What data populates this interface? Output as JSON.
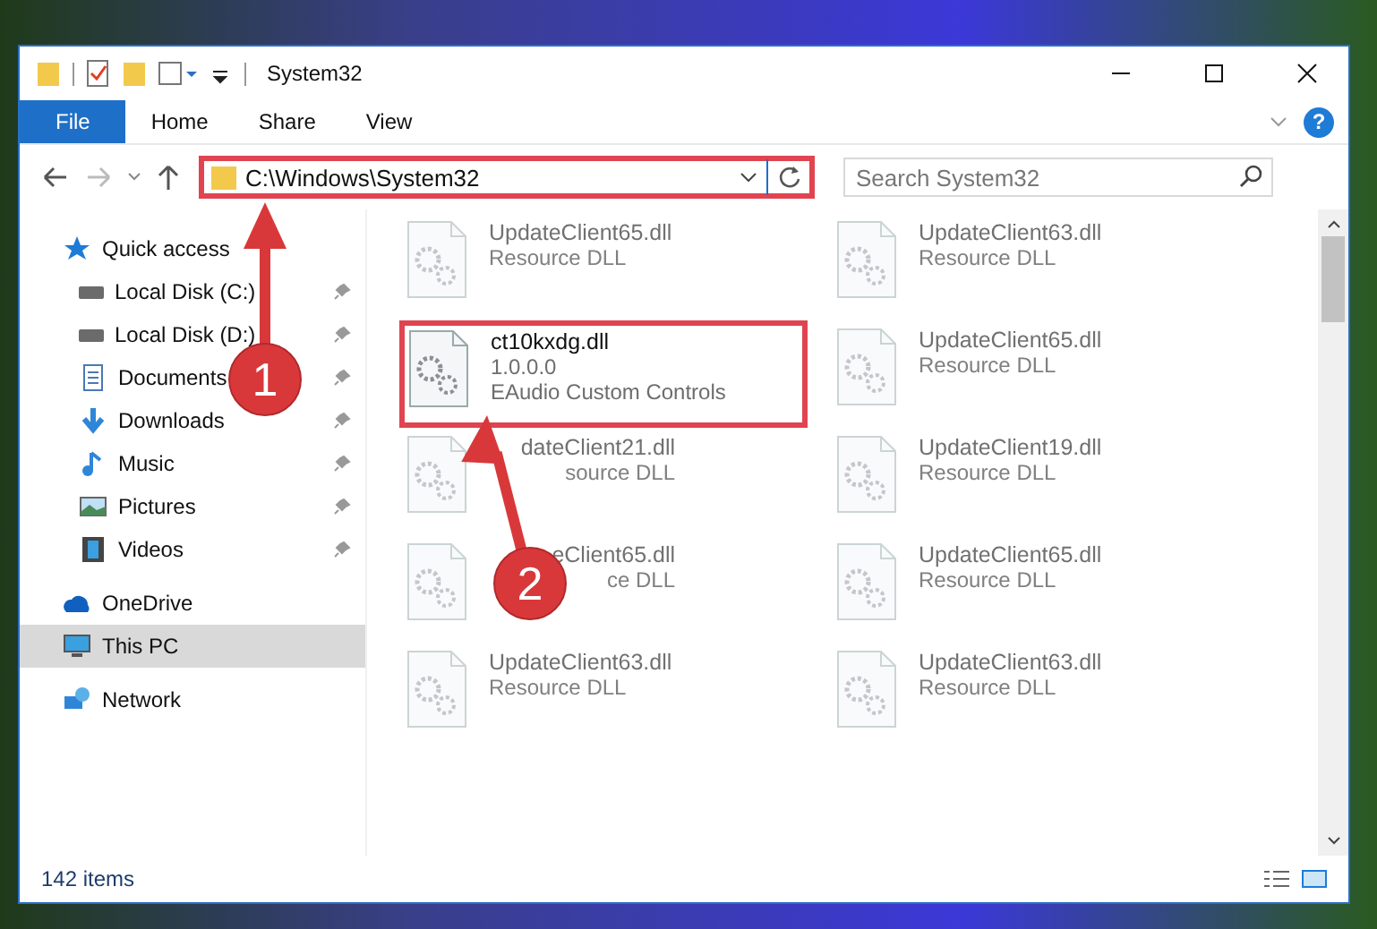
{
  "window": {
    "title": "System32"
  },
  "ribbon_tabs": [
    {
      "label": "File",
      "selected": true
    },
    {
      "label": "Home",
      "selected": false
    },
    {
      "label": "Share",
      "selected": false
    },
    {
      "label": "View",
      "selected": false
    }
  ],
  "help_button": {
    "label": "?"
  },
  "address_bar": {
    "path": "C:\\Windows\\System32",
    "highlighted": true
  },
  "search": {
    "placeholder": "Search System32"
  },
  "sidebar": {
    "items": [
      {
        "label": "Quick access",
        "kind": "star",
        "pinned": false,
        "selected": false,
        "children": [
          {
            "label": "Local Disk (C:)",
            "kind": "drive",
            "pinned": true,
            "selected": false
          },
          {
            "label": "Local Disk (D:)",
            "kind": "drive",
            "pinned": true,
            "selected": false
          },
          {
            "label": "Documents",
            "kind": "documents",
            "pinned": true,
            "selected": false
          },
          {
            "label": "Downloads",
            "kind": "downloads",
            "pinned": true,
            "selected": false
          },
          {
            "label": "Music",
            "kind": "music",
            "pinned": true,
            "selected": false
          },
          {
            "label": "Pictures",
            "kind": "pictures",
            "pinned": true,
            "selected": false
          },
          {
            "label": "Videos",
            "kind": "videos",
            "pinned": true,
            "selected": false
          }
        ]
      },
      {
        "label": "OneDrive",
        "kind": "cloud",
        "pinned": false,
        "selected": false
      },
      {
        "label": "This PC",
        "kind": "computer",
        "pinned": false,
        "selected": true
      },
      {
        "label": "Network",
        "kind": "network",
        "pinned": false,
        "selected": false
      }
    ]
  },
  "files": [
    {
      "name": "UpdateClient65.dll",
      "details": [
        "Resource DLL"
      ],
      "blurred": true,
      "highlighted": false,
      "covered": false
    },
    {
      "name": "UpdateClient63.dll",
      "details": [
        "Resource DLL"
      ],
      "blurred": true,
      "highlighted": false,
      "covered": false
    },
    {
      "name": "ct10kxdg.dll",
      "details": [
        "1.0.0.0",
        "EAudio Custom Controls"
      ],
      "blurred": false,
      "highlighted": true,
      "covered": false
    },
    {
      "name": "UpdateClient65.dll",
      "details": [
        "Resource DLL"
      ],
      "blurred": true,
      "highlighted": false,
      "covered": false
    },
    {
      "name": "dateClient21.dll",
      "details": [
        "source DLL"
      ],
      "blurred": true,
      "highlighted": false,
      "covered": true
    },
    {
      "name": "UpdateClient19.dll",
      "details": [
        "Resource DLL"
      ],
      "blurred": true,
      "highlighted": false,
      "covered": false
    },
    {
      "name": "eClient65.dll",
      "details": [
        "ce DLL"
      ],
      "blurred": true,
      "highlighted": false,
      "covered": true
    },
    {
      "name": "UpdateClient65.dll",
      "details": [
        "Resource DLL"
      ],
      "blurred": true,
      "highlighted": false,
      "covered": false
    },
    {
      "name": "UpdateClient63.dll",
      "details": [
        "Resource DLL"
      ],
      "blurred": true,
      "highlighted": false,
      "covered": false
    },
    {
      "name": "UpdateClient63.dll",
      "details": [
        "Resource DLL"
      ],
      "blurred": true,
      "highlighted": false,
      "covered": false
    }
  ],
  "status_bar": {
    "count": "142 items"
  },
  "callouts": [
    {
      "number": "1"
    },
    {
      "number": "2"
    }
  ]
}
